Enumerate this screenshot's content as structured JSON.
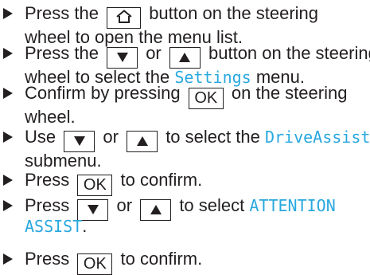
{
  "steps": [
    {
      "l1_a": "Press the",
      "l1_b": "button on the steering",
      "l2": "wheel to open the menu list."
    },
    {
      "l1_a": "Press the",
      "l1_b": "or",
      "l1_c": "button on the steering",
      "l2_a": "wheel to select the",
      "l2_hl": "Settings",
      "l2_b": "menu."
    },
    {
      "l1_a": "Confirm by pressing",
      "l1_b": "on the steering",
      "l2": "wheel."
    },
    {
      "l1_a": "Use",
      "l1_b": "or",
      "l1_c": "to select the",
      "l1_hl": "DriveAssist",
      "l2": "submenu."
    },
    {
      "l1_a": "Press",
      "l1_b": "to confirm."
    },
    {
      "l1_a": "Press",
      "l1_b": "or",
      "l1_c": "to select",
      "l1_hl": "ATTENTION",
      "l2_hl": "ASSIST",
      "l2_b": "."
    },
    {
      "l1_a": "Press",
      "l1_b": "to confirm."
    }
  ],
  "keys": {
    "ok": "OK",
    "home_icon": "home-icon",
    "down_icon": "down-triangle-icon",
    "up_icon": "up-triangle-icon"
  },
  "colors": {
    "text": "#231f20",
    "highlight": "#29a8df"
  }
}
